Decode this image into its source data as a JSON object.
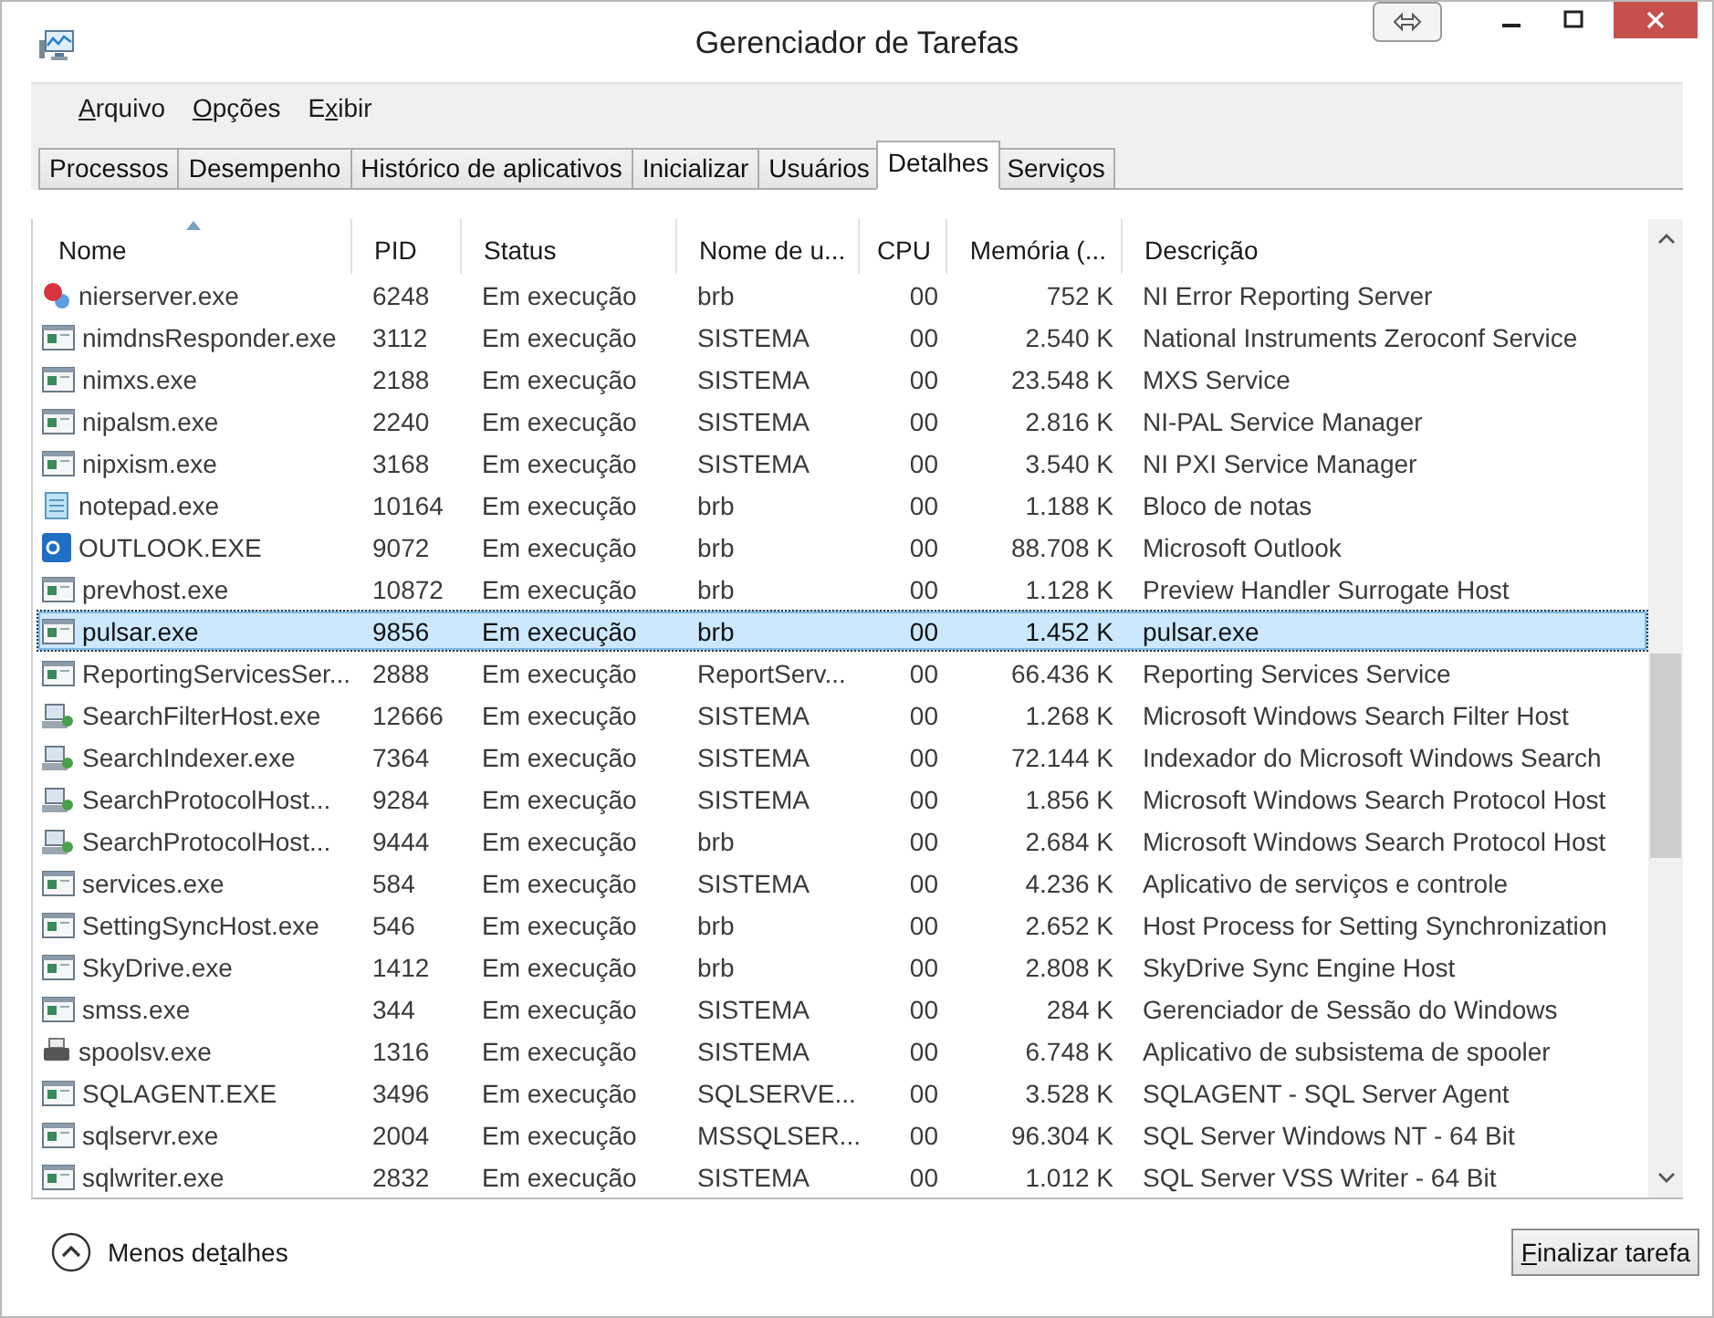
{
  "window": {
    "title": "Gerenciador de Tarefas"
  },
  "menu": [
    {
      "key": "A",
      "post": "rquivo"
    },
    {
      "key": "O",
      "post": "pções"
    },
    {
      "pre": "E",
      "key": "x",
      "post": "ibir"
    }
  ],
  "tabs": [
    {
      "label": "Processos",
      "selected": false
    },
    {
      "label": "Desempenho",
      "selected": false
    },
    {
      "label": "Histórico de aplicativos",
      "selected": false
    },
    {
      "label": "Inicializar",
      "selected": false
    },
    {
      "label": "Usuários",
      "selected": false
    },
    {
      "label": "Detalhes",
      "selected": true
    },
    {
      "label": "Serviços",
      "selected": false
    }
  ],
  "table": {
    "columns": [
      {
        "label": "Nome",
        "sorted": true
      },
      {
        "label": "PID",
        "sorted": false
      },
      {
        "label": "Status",
        "sorted": false
      },
      {
        "label": "Nome de u...",
        "sorted": false
      },
      {
        "label": "CPU",
        "sorted": false
      },
      {
        "label": "Memória (...",
        "sorted": false
      },
      {
        "label": "Descrição",
        "sorted": false
      }
    ],
    "rows": [
      {
        "kind": "error",
        "selected": false,
        "cells": [
          "nierserver.exe",
          "6248",
          "Em execução",
          "brb",
          "00",
          "752 K",
          "NI Error Reporting Server"
        ]
      },
      {
        "kind": "app",
        "selected": false,
        "cells": [
          "nimdnsResponder.exe",
          "3112",
          "Em execução",
          "SISTEMA",
          "00",
          "2.540 K",
          "National Instruments Zeroconf Service"
        ]
      },
      {
        "kind": "app",
        "selected": false,
        "cells": [
          "nimxs.exe",
          "2188",
          "Em execução",
          "SISTEMA",
          "00",
          "23.548 K",
          "MXS Service"
        ]
      },
      {
        "kind": "app",
        "selected": false,
        "cells": [
          "nipalsm.exe",
          "2240",
          "Em execução",
          "SISTEMA",
          "00",
          "2.816 K",
          "NI-PAL Service Manager"
        ]
      },
      {
        "kind": "app",
        "selected": false,
        "cells": [
          "nipxism.exe",
          "3168",
          "Em execução",
          "SISTEMA",
          "00",
          "3.540 K",
          "NI PXI Service Manager"
        ]
      },
      {
        "kind": "notepad",
        "selected": false,
        "cells": [
          "notepad.exe",
          "10164",
          "Em execução",
          "brb",
          "00",
          "1.188 K",
          "Bloco de notas"
        ]
      },
      {
        "kind": "mail",
        "selected": false,
        "cells": [
          "OUTLOOK.EXE",
          "9072",
          "Em execução",
          "brb",
          "00",
          "88.708 K",
          "Microsoft Outlook"
        ]
      },
      {
        "kind": "app",
        "selected": false,
        "cells": [
          "prevhost.exe",
          "10872",
          "Em execução",
          "brb",
          "00",
          "1.128 K",
          "Preview Handler Surrogate Host"
        ]
      },
      {
        "kind": "app",
        "selected": true,
        "cells": [
          "pulsar.exe",
          "9856",
          "Em execução",
          "brb",
          "00",
          "1.452 K",
          "pulsar.exe"
        ]
      },
      {
        "kind": "app",
        "selected": false,
        "cells": [
          "ReportingServicesSer...",
          "2888",
          "Em execução",
          "ReportServ...",
          "00",
          "66.436 K",
          "Reporting Services Service"
        ]
      },
      {
        "kind": "search",
        "selected": false,
        "cells": [
          "SearchFilterHost.exe",
          "12666",
          "Em execução",
          "SISTEMA",
          "00",
          "1.268 K",
          "Microsoft Windows Search Filter Host"
        ]
      },
      {
        "kind": "search",
        "selected": false,
        "cells": [
          "SearchIndexer.exe",
          "7364",
          "Em execução",
          "SISTEMA",
          "00",
          "72.144 K",
          "Indexador do Microsoft Windows Search"
        ]
      },
      {
        "kind": "search",
        "selected": false,
        "cells": [
          "SearchProtocolHost...",
          "9284",
          "Em execução",
          "SISTEMA",
          "00",
          "1.856 K",
          "Microsoft Windows Search Protocol Host"
        ]
      },
      {
        "kind": "search",
        "selected": false,
        "cells": [
          "SearchProtocolHost...",
          "9444",
          "Em execução",
          "brb",
          "00",
          "2.684 K",
          "Microsoft Windows Search Protocol Host"
        ]
      },
      {
        "kind": "app",
        "selected": false,
        "cells": [
          "services.exe",
          "584",
          "Em execução",
          "SISTEMA",
          "00",
          "4.236 K",
          "Aplicativo de serviços e controle"
        ]
      },
      {
        "kind": "app",
        "selected": false,
        "cells": [
          "SettingSyncHost.exe",
          "546",
          "Em execução",
          "brb",
          "00",
          "2.652 K",
          "Host Process for Setting Synchronization"
        ]
      },
      {
        "kind": "app",
        "selected": false,
        "cells": [
          "SkyDrive.exe",
          "1412",
          "Em execução",
          "brb",
          "00",
          "2.808 K",
          "SkyDrive Sync Engine Host"
        ]
      },
      {
        "kind": "app",
        "selected": false,
        "cells": [
          "smss.exe",
          "344",
          "Em execução",
          "SISTEMA",
          "00",
          "284 K",
          "Gerenciador de Sessão do Windows"
        ]
      },
      {
        "kind": "printer",
        "selected": false,
        "cells": [
          "spoolsv.exe",
          "1316",
          "Em execução",
          "SISTEMA",
          "00",
          "6.748 K",
          "Aplicativo de subsistema de spooler"
        ]
      },
      {
        "kind": "app",
        "selected": false,
        "cells": [
          "SQLAGENT.EXE",
          "3496",
          "Em execução",
          "SQLSERVE...",
          "00",
          "3.528 K",
          "SQLAGENT - SQL Server Agent"
        ]
      },
      {
        "kind": "app",
        "selected": false,
        "cells": [
          "sqlservr.exe",
          "2004",
          "Em execução",
          "MSSQLSER...",
          "00",
          "96.304 K",
          "SQL Server Windows NT - 64 Bit"
        ]
      },
      {
        "kind": "app",
        "selected": false,
        "cells": [
          "sqlwriter.exe",
          "2832",
          "Em execução",
          "SISTEMA",
          "00",
          "1.012 K",
          "SQL Server VSS Writer - 64 Bit"
        ]
      }
    ]
  },
  "footer": {
    "toggle": {
      "pre": "Menos de",
      "key": "t",
      "post": "alhes"
    },
    "button": {
      "key": "F",
      "post": "inalizar tarefa"
    }
  }
}
